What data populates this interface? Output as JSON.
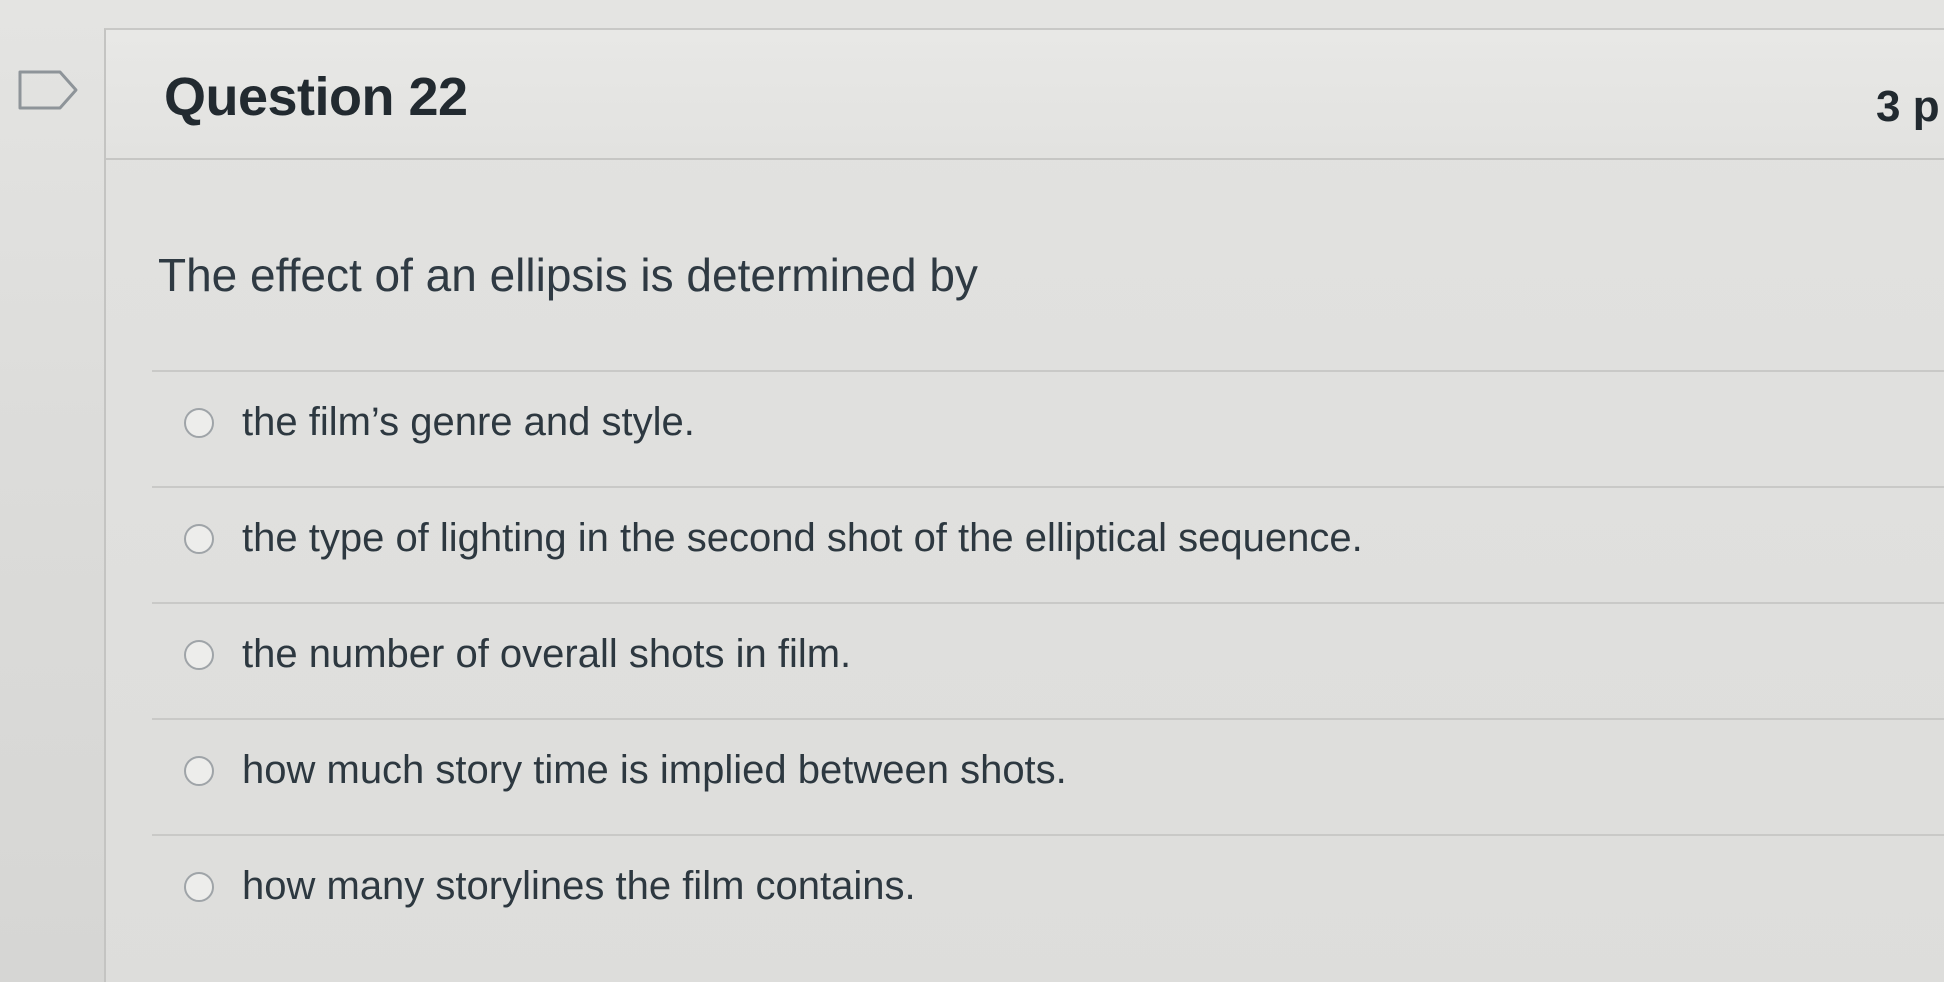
{
  "question": {
    "title": "Question 22",
    "points": "3 p",
    "prompt": "The effect of an ellipsis is determined by"
  },
  "answers": [
    {
      "label": "the film’s genre and style."
    },
    {
      "label": "the type of lighting in the second shot of the elliptical sequence."
    },
    {
      "label": "the number of overall shots in film."
    },
    {
      "label": "how much story time is implied between shots."
    },
    {
      "label": "how many storylines the film contains."
    }
  ],
  "icons": {
    "flag": "flag-question-icon",
    "radio": "radio-button-icon"
  }
}
